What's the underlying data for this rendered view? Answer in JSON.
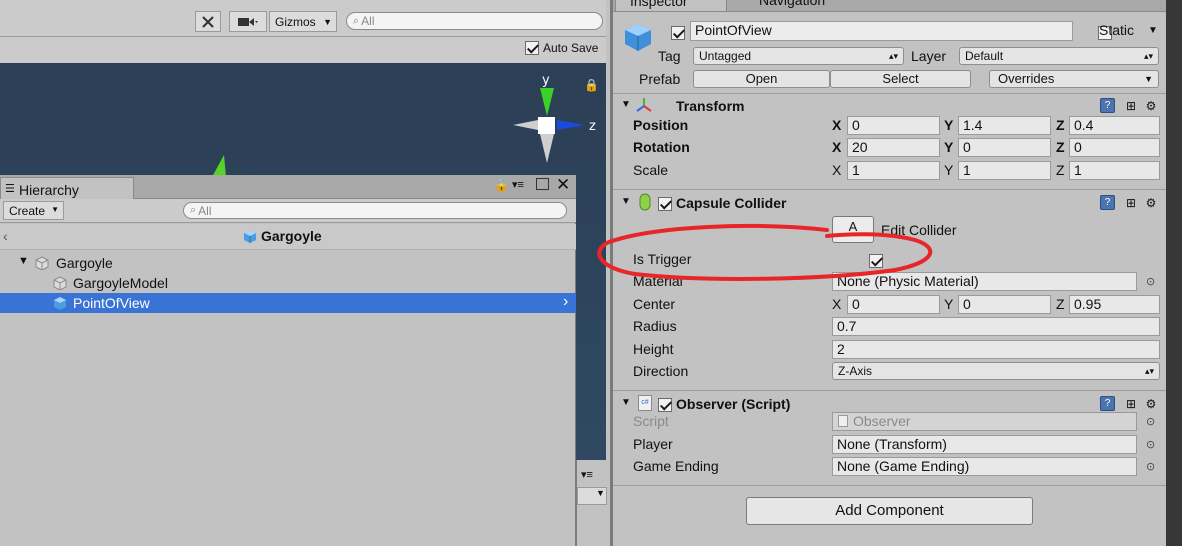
{
  "scene": {
    "gizmos_label": "Gizmos",
    "search_placeholder": "All",
    "autosave_label": "Auto Save",
    "axis_y": "y",
    "axis_z": "z"
  },
  "hierarchy": {
    "tab_label": "Hierarchy",
    "create_label": "Create",
    "search_placeholder": "All",
    "scene_name": "Gargoyle",
    "items": [
      {
        "label": "Gargoyle"
      },
      {
        "label": "GargoyleModel"
      },
      {
        "label": "PointOfView"
      }
    ]
  },
  "inspector": {
    "tabs": [
      "Inspector",
      "Navigation"
    ],
    "object_name": "PointOfView",
    "static_label": "Static",
    "tag_label": "Tag",
    "tag_value": "Untagged",
    "layer_label": "Layer",
    "layer_value": "Default",
    "prefab_label": "Prefab",
    "open_label": "Open",
    "select_label": "Select",
    "overrides_label": "Overrides",
    "transform": {
      "title": "Transform",
      "position_label": "Position",
      "rotation_label": "Rotation",
      "scale_label": "Scale",
      "position": {
        "x": "0",
        "y": "1.4",
        "z": "0.4"
      },
      "rotation": {
        "x": "20",
        "y": "0",
        "z": "0"
      },
      "scale": {
        "x": "1",
        "y": "1",
        "z": "1"
      },
      "axis_x": "X",
      "axis_y": "Y",
      "axis_z": "Z"
    },
    "capsule": {
      "title": "Capsule Collider",
      "edit_button_glyph": "A",
      "edit_label": "Edit Collider",
      "is_trigger_label": "Is Trigger",
      "material_label": "Material",
      "material_value": "None (Physic Material)",
      "center_label": "Center",
      "center": {
        "x": "0",
        "y": "0",
        "z": "0.95"
      },
      "radius_label": "Radius",
      "radius_value": "0.7",
      "height_label": "Height",
      "height_value": "2",
      "direction_label": "Direction",
      "direction_value": "Z-Axis"
    },
    "observer": {
      "title": "Observer (Script)",
      "script_label": "Script",
      "script_value": "Observer",
      "player_label": "Player",
      "player_value": "None (Transform)",
      "game_ending_label": "Game Ending",
      "game_ending_value": "None (Game Ending)",
      "script_icon_text": "c#"
    },
    "add_component_label": "Add Component"
  },
  "colors": {
    "selection": "#3a73d6",
    "annotation": "#e8262a",
    "scene_bg": "#2b3f55"
  }
}
